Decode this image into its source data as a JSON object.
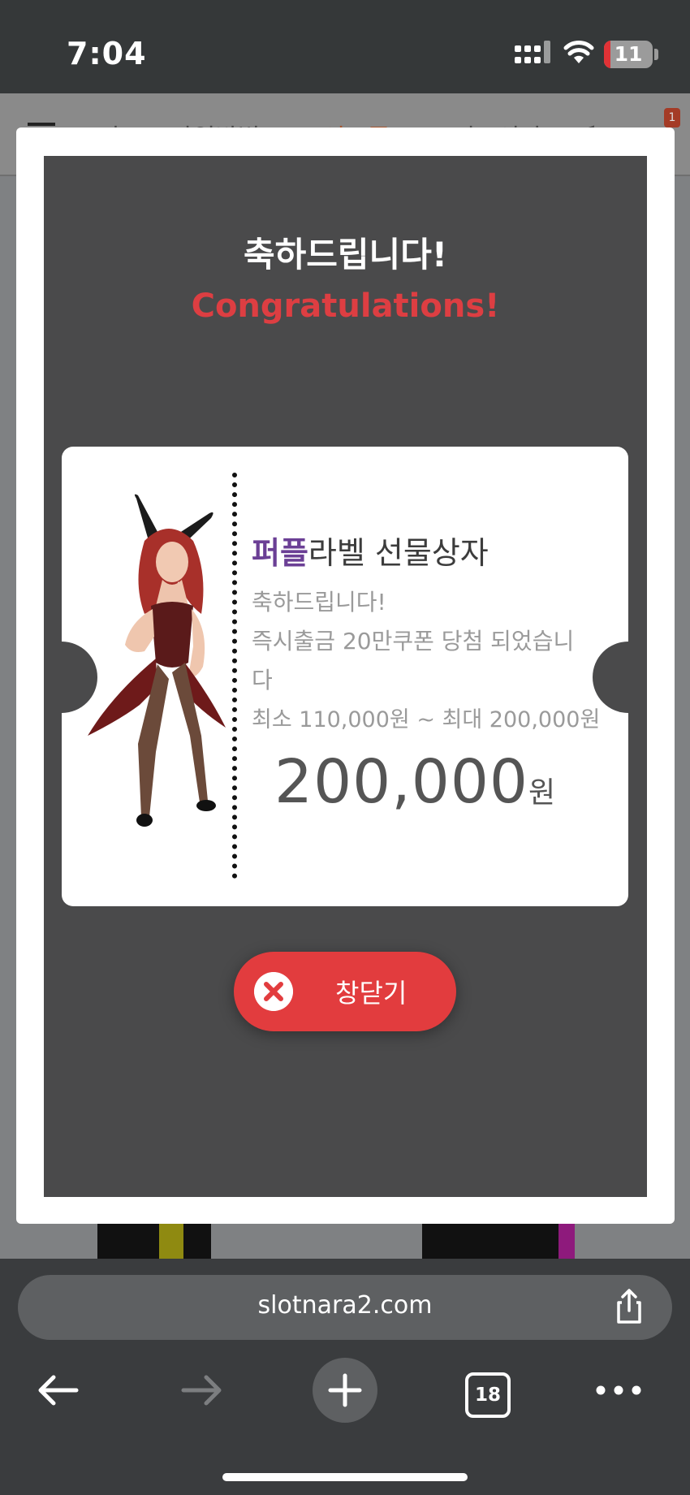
{
  "status_bar": {
    "time": "7:04",
    "battery": "11",
    "battery_level_percent": 11
  },
  "site_nav": {
    "items": [
      "이...",
      "가입방법",
      "포인트존",
      "프리코인당",
      "<"
    ],
    "badge": "1"
  },
  "modal": {
    "title_ko": "축하드립니다!",
    "title_en": "Congratulations!",
    "ticket": {
      "title_highlight": "퍼플",
      "title_rest": "라벨 선물상자",
      "line1": "축하드립니다!",
      "line2": "즉시출금 20만쿠폰 당첨 되었습니",
      "line3": "다",
      "line4": "최소 110,000원 ~ 최대 200,000원",
      "amount": "200,000",
      "amount_unit": "원"
    },
    "close_button": "창닫기"
  },
  "browser": {
    "url": "slotnara2.com",
    "tabs_count": "18"
  },
  "colors": {
    "accent_red": "#e23c3e",
    "title_red": "#dd3e42",
    "purple": "#6b3f95"
  },
  "icons": [
    "signal-icon",
    "wifi-icon",
    "battery-icon",
    "share-icon",
    "back-arrow-icon",
    "forward-arrow-icon",
    "plus-icon",
    "tabs-icon",
    "more-icon",
    "close-x-icon"
  ]
}
